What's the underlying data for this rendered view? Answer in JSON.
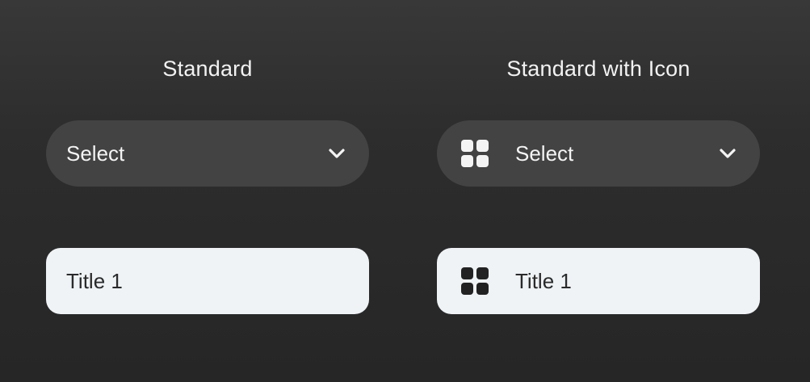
{
  "standard": {
    "heading": "Standard",
    "dropdown": {
      "label": "Select",
      "icon": "chevron-down-icon"
    },
    "option": {
      "label": "Title 1"
    }
  },
  "standard_with_icon": {
    "heading": "Standard with Icon",
    "dropdown": {
      "label": "Select",
      "leading_icon": "grid-icon",
      "icon": "chevron-down-icon"
    },
    "option": {
      "label": "Title 1",
      "leading_icon": "grid-icon"
    }
  },
  "colors": {
    "background": "#2d2d2d",
    "dropdown_fill": "#434343",
    "option_fill": "#eff3f6",
    "text_light": "#f4f4f4",
    "text_dark": "#2a2a2a"
  }
}
